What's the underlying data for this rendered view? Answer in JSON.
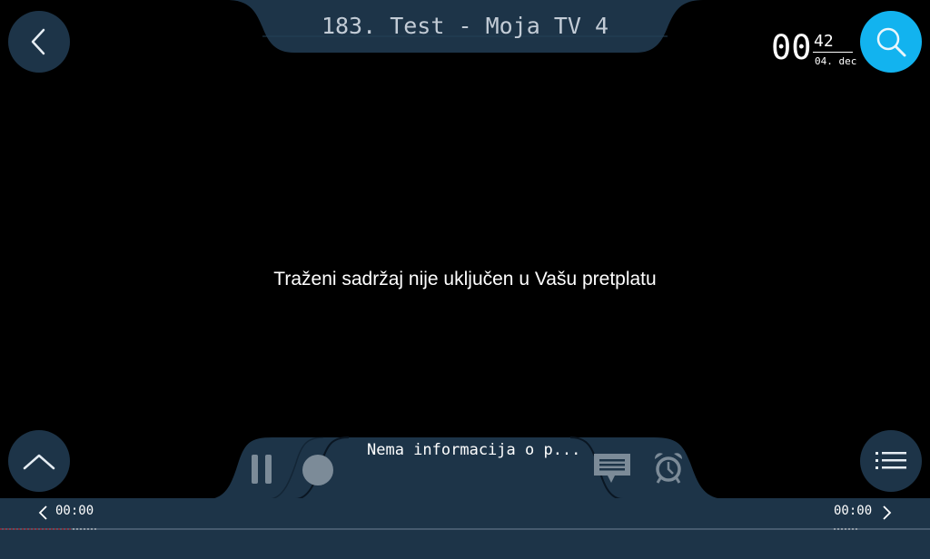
{
  "header": {
    "channel_title": "183. Test - Moja TV 4"
  },
  "clock": {
    "hour": "00",
    "minute": "42",
    "date": "04. dec"
  },
  "player": {
    "message": "Traženi sadržaj nije uključen u Vašu pretplatu",
    "program_info": "Nema informacija o p..."
  },
  "timeline": {
    "start_time": "00:00",
    "end_time": "00:00"
  },
  "icons": {
    "back": "chevron-left-icon",
    "search": "search-icon",
    "expand": "chevron-up-icon",
    "menu": "list-menu-icon",
    "pause": "pause-icon",
    "record": "record-icon",
    "chat": "chat-icon",
    "alarm": "alarm-clock-icon"
  },
  "colors": {
    "panel": "#1d3448",
    "accent": "#12b3ef",
    "background": "#000000",
    "progress_red": "#e0242c"
  }
}
